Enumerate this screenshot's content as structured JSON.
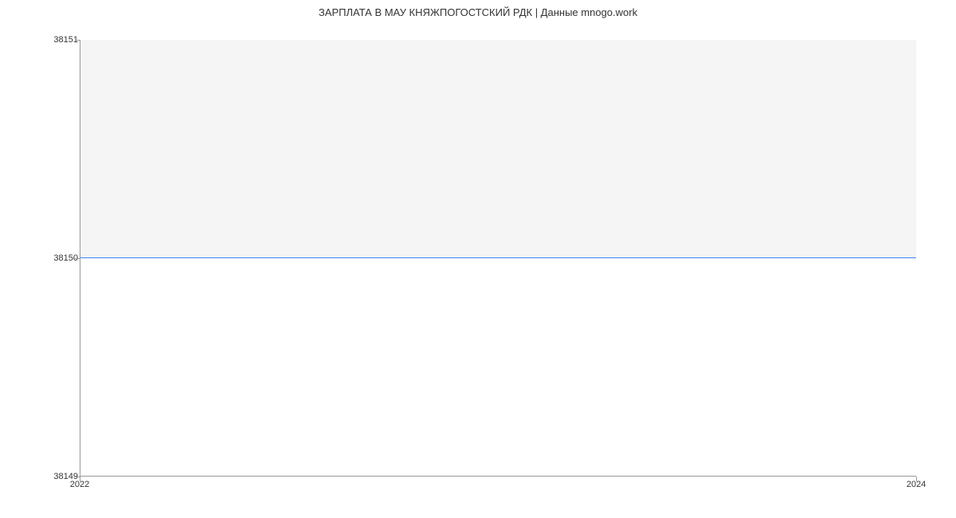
{
  "chart_data": {
    "type": "line",
    "title": "ЗАРПЛАТА В МАУ КНЯЖПОГОСТСКИЙ РДК | Данные mnogo.work",
    "xlabel": "",
    "ylabel": "",
    "x": [
      2022,
      2024
    ],
    "values": [
      38150,
      38150
    ],
    "xlim": [
      2022,
      2024
    ],
    "ylim": [
      38149,
      38151
    ],
    "y_ticks": [
      38149,
      38150,
      38151
    ],
    "x_ticks": [
      2022,
      2024
    ]
  }
}
